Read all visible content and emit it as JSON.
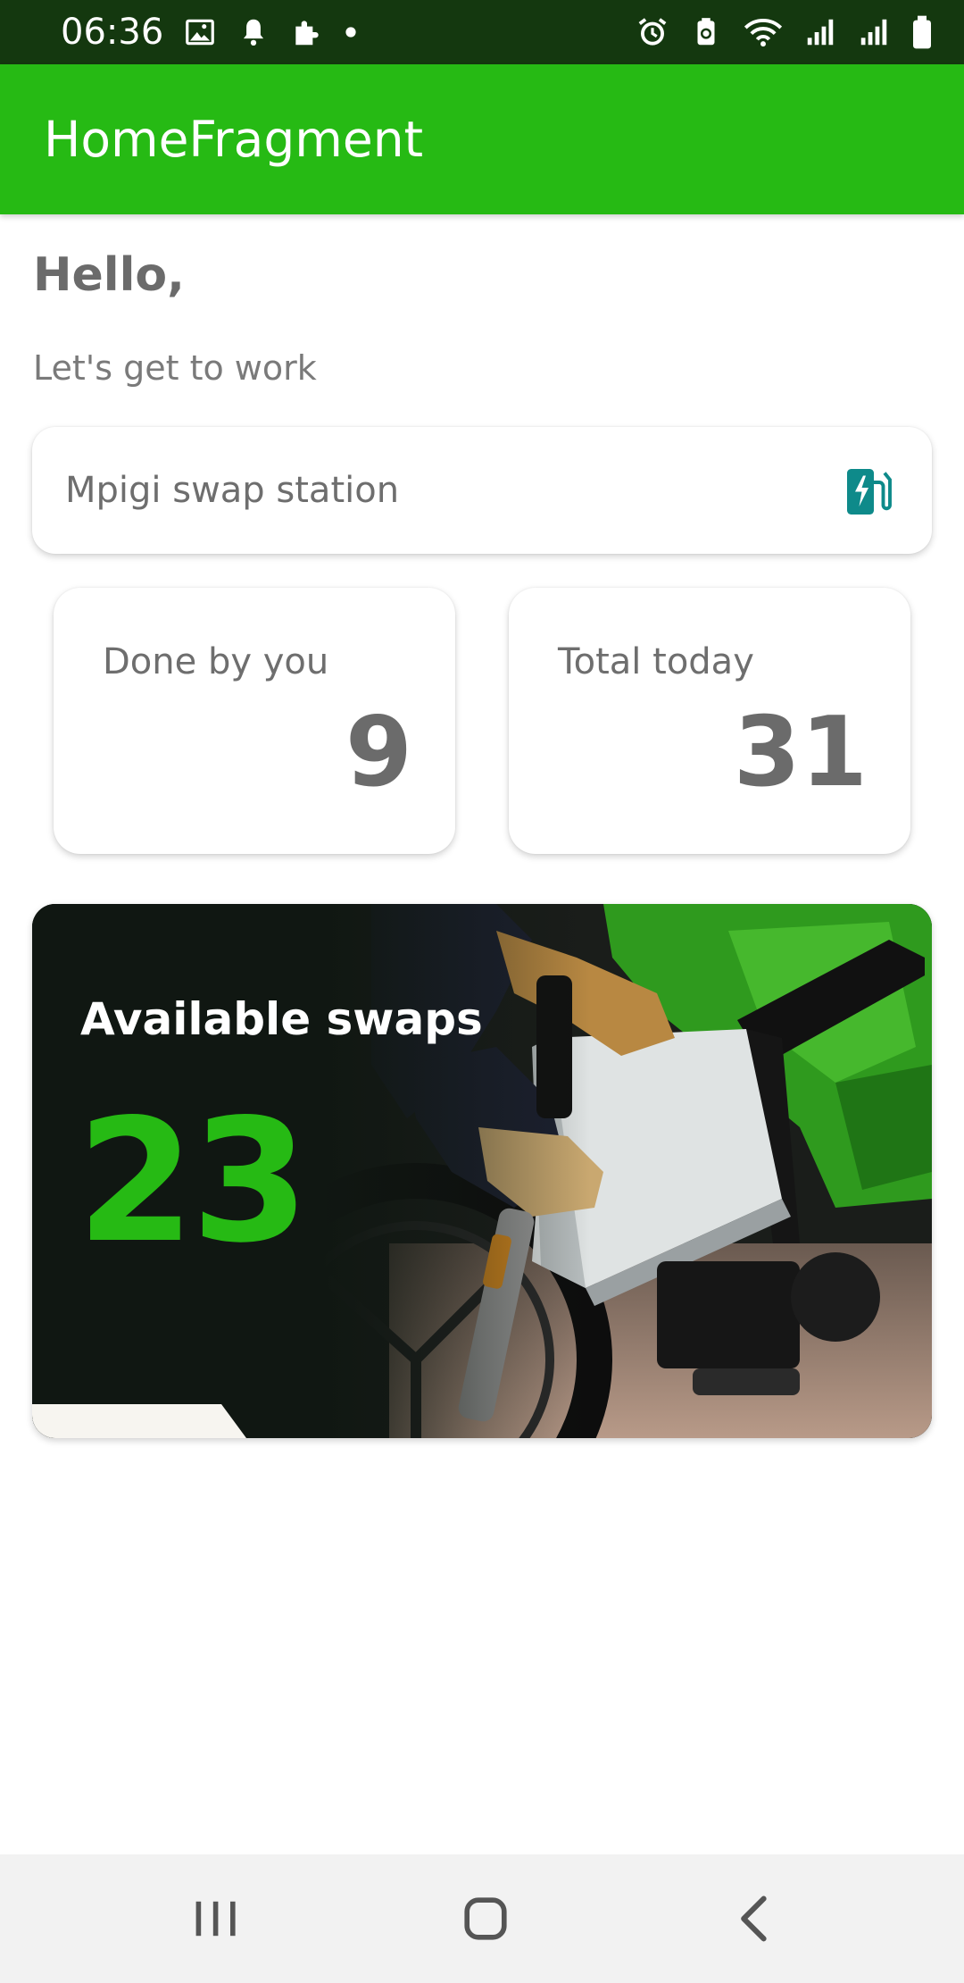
{
  "status_bar": {
    "time": "06:36",
    "left_icons": [
      "image-icon",
      "bell-icon",
      "puzzle-icon",
      "dot-icon"
    ],
    "right_icons": [
      "alarm-icon",
      "battery-saver-icon",
      "wifi-icon",
      "signal-icon",
      "signal-icon",
      "battery-icon"
    ]
  },
  "app_bar": {
    "title": "HomeFragment",
    "color": "#26ba14"
  },
  "greeting": {
    "title": "Hello,",
    "subtitle": "Let's get to work"
  },
  "station": {
    "name": "Mpigi swap station",
    "icon": "ev-station-icon",
    "icon_color": "#0e8a8a"
  },
  "stats": [
    {
      "label": "Done by you",
      "value": "9"
    },
    {
      "label": "Total today",
      "value": "31"
    }
  ],
  "swaps": {
    "title": "Available swaps",
    "value": "23",
    "value_color": "#26ba14",
    "image": "battery-swap-photo"
  },
  "nav_bar": {
    "buttons": [
      "recents-icon",
      "home-icon",
      "back-icon"
    ]
  }
}
